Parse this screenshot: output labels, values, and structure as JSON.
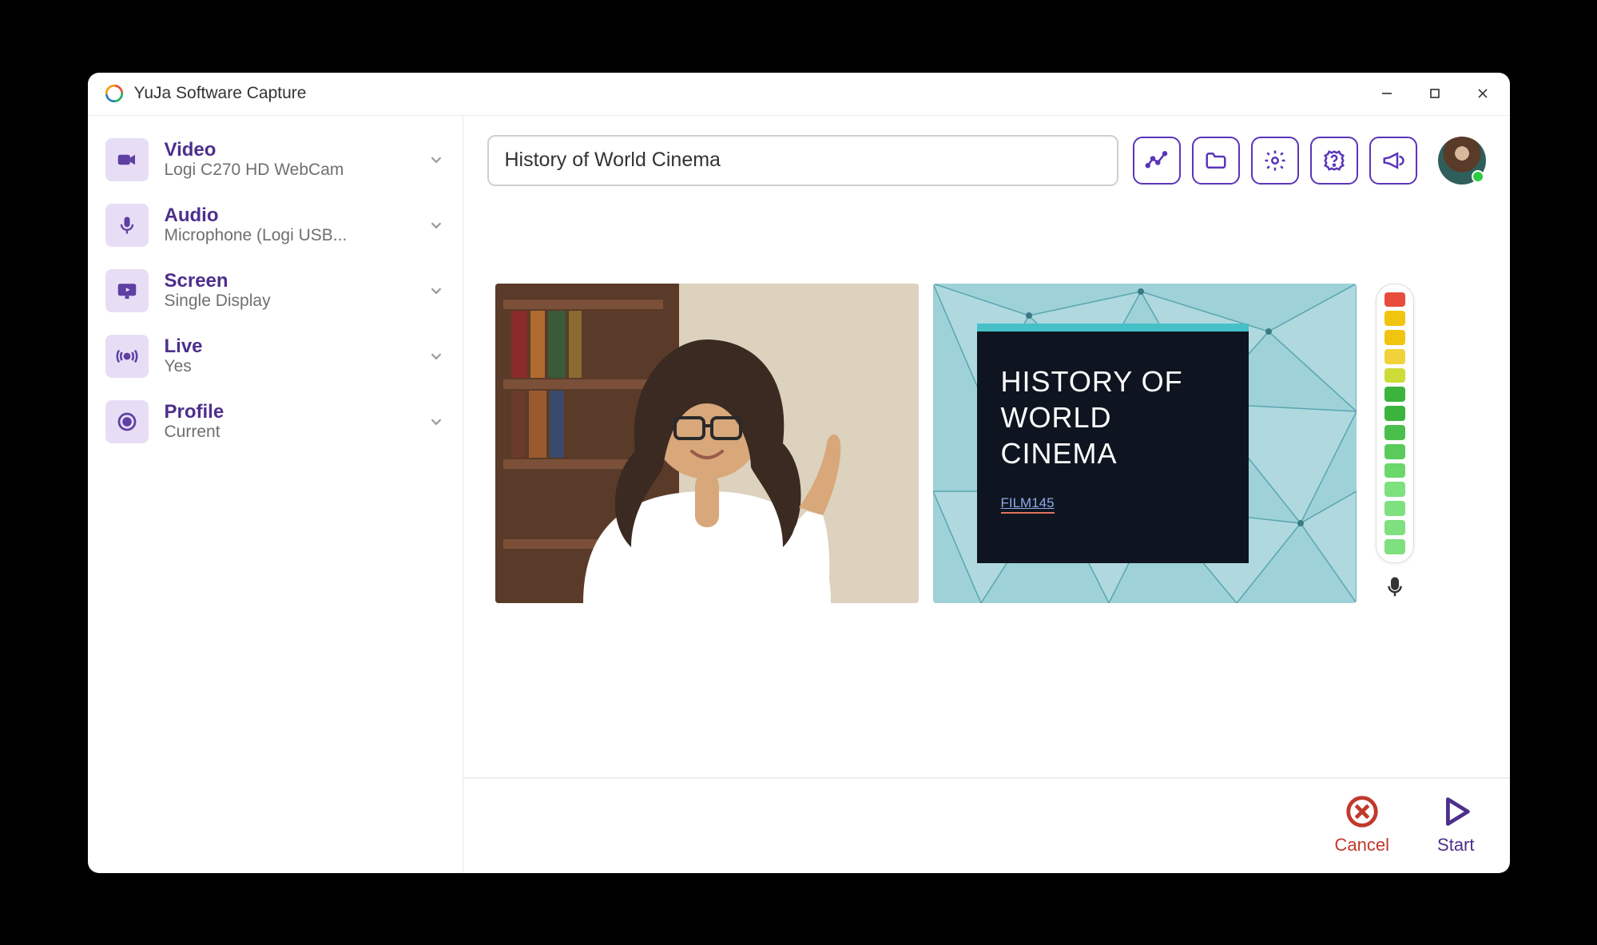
{
  "window": {
    "title": "YuJa Software Capture"
  },
  "sidebar": {
    "items": [
      {
        "title": "Video",
        "sub": "Logi C270 HD WebCam",
        "icon": "video-camera-icon"
      },
      {
        "title": "Audio",
        "sub": "Microphone (Logi USB...",
        "icon": "microphone-icon"
      },
      {
        "title": "Screen",
        "sub": "Single Display",
        "icon": "monitor-icon"
      },
      {
        "title": "Live",
        "sub": "Yes",
        "icon": "broadcast-icon"
      },
      {
        "title": "Profile",
        "sub": "Current",
        "icon": "profile-record-icon"
      }
    ]
  },
  "toolbar": {
    "title_input_value": "History of World Cinema",
    "buttons": [
      {
        "name": "analytics-button",
        "icon": "analytics-icon"
      },
      {
        "name": "folder-button",
        "icon": "folder-icon"
      },
      {
        "name": "settings-button",
        "icon": "gear-icon"
      },
      {
        "name": "help-button",
        "icon": "help-icon"
      },
      {
        "name": "announce-button",
        "icon": "megaphone-icon"
      }
    ],
    "user_status": "online"
  },
  "previews": {
    "camera_label": "webcam-preview",
    "screen_label": "screen-share-preview",
    "slide": {
      "title_line1": "HISTORY OF",
      "title_line2": "WORLD",
      "title_line3": "CINEMA",
      "code": "FILM145"
    }
  },
  "audio_meter": {
    "segments": [
      {
        "color": "#7ee07e"
      },
      {
        "color": "#7ee07e"
      },
      {
        "color": "#7ee07e"
      },
      {
        "color": "#7ee07e"
      },
      {
        "color": "#6ad86a"
      },
      {
        "color": "#5acb5a"
      },
      {
        "color": "#4bbf4b"
      },
      {
        "color": "#3cb33c"
      },
      {
        "color": "#3cb33c"
      },
      {
        "color": "#cddc39"
      },
      {
        "color": "#f1d23b"
      },
      {
        "color": "#f1c40f"
      },
      {
        "color": "#f1c40f"
      },
      {
        "color": "#e74c3c"
      }
    ]
  },
  "footer": {
    "cancel_label": "Cancel",
    "start_label": "Start"
  }
}
